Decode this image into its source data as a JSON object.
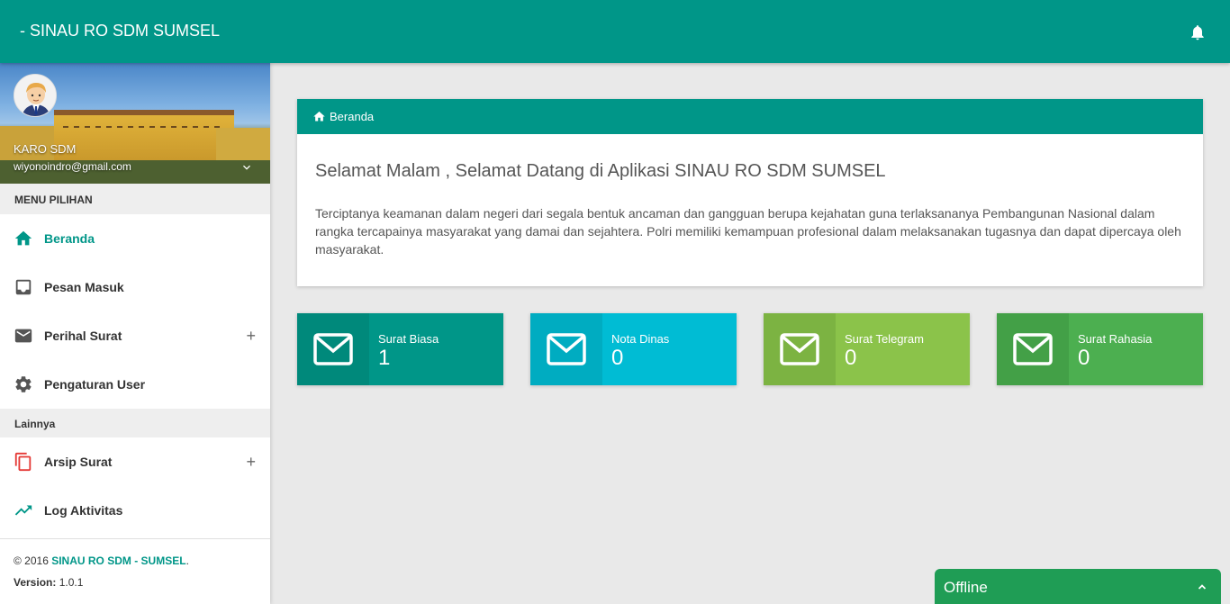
{
  "app": {
    "title": "- SINAU RO SDM SUMSEL"
  },
  "user": {
    "name": "KARO SDM",
    "email": "wiyonoindro@gmail.com"
  },
  "sidebar": {
    "menu_header": "MENU PILIHAN",
    "items": [
      {
        "label": "Beranda",
        "icon": "home-icon",
        "active": true
      },
      {
        "label": "Pesan Masuk",
        "icon": "inbox-icon"
      },
      {
        "label": "Perihal Surat",
        "icon": "mail-icon",
        "expand": "+"
      },
      {
        "label": "Pengaturan User",
        "icon": "gear-icon"
      }
    ],
    "sub_header": "Lainnya",
    "other_items": [
      {
        "label": "Arsip Surat",
        "icon": "copy-icon",
        "expand": "+"
      },
      {
        "label": "Log Aktivitas",
        "icon": "trending-icon"
      }
    ]
  },
  "footer": {
    "copyright_prefix": "© 2016 ",
    "brand": "SINAU RO SDM - SUMSEL",
    "brand_suffix": ".",
    "version_label": "Version:",
    "version_value": " 1.0.1"
  },
  "card": {
    "breadcrumb": "Beranda",
    "greeting": "Selamat Malam , Selamat Datang di Aplikasi SINAU RO SDM SUMSEL",
    "description": "Terciptanya keamanan dalam negeri dari segala bentuk ancaman dan gangguan berupa kejahatan guna terlaksananya Pembangunan Nasional dalam rangka tercapainya masyarakat yang damai dan sejahtera. Polri memiliki kemampuan profesional dalam melaksanakan tugasnya dan dapat dipercaya oleh masyarakat."
  },
  "stats": [
    {
      "label": "Surat Biasa",
      "value": "1",
      "color": "#009688",
      "icon_bg": "#00897b"
    },
    {
      "label": "Nota Dinas",
      "value": "0",
      "color": "#00bcd4",
      "icon_bg": "#00acc1"
    },
    {
      "label": "Surat Telegram",
      "value": "0",
      "color": "#8bc34a",
      "icon_bg": "#7cb342"
    },
    {
      "label": "Surat Rahasia",
      "value": "0",
      "color": "#4caf50",
      "icon_bg": "#43a047"
    }
  ],
  "chat": {
    "status": "Offline"
  },
  "colors": {
    "primary": "#009688",
    "background": "#e9e9e9",
    "chat": "#1f9d55"
  }
}
